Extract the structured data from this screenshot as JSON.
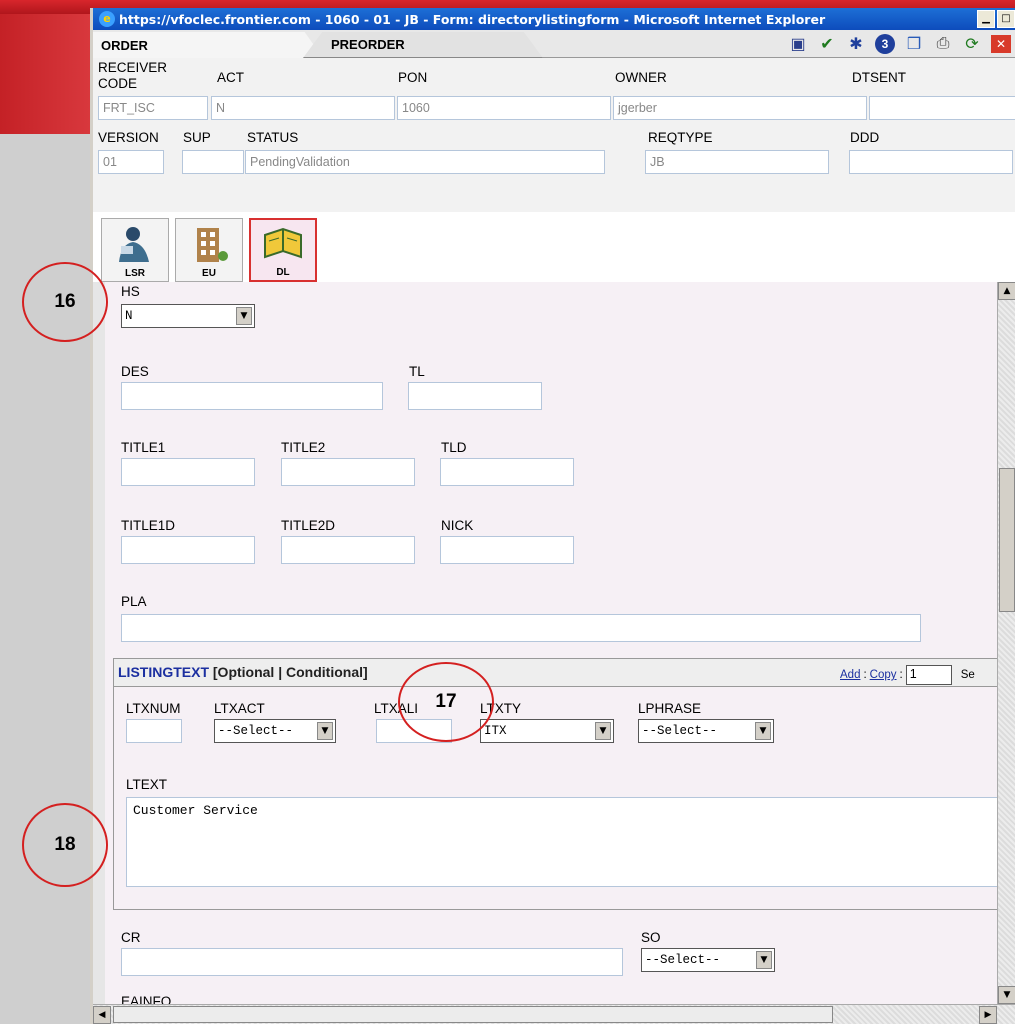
{
  "window": {
    "title": "https://vfoclec.frontier.com - 1060 - 01 - JB - Form: directorylistingform - Microsoft Internet Explorer"
  },
  "tabs": {
    "order": "ORDER",
    "preorder": "PREORDER"
  },
  "toolbar": {
    "icons": [
      "save-icon",
      "check-icon",
      "runner-icon",
      "info-3-icon",
      "book-icon",
      "print-icon",
      "refresh-icon",
      "close-icon"
    ],
    "info_number": "3"
  },
  "header": {
    "labels": {
      "receiver_code": "RECEIVER CODE",
      "act": "ACT",
      "pon": "PON",
      "owner": "OWNER",
      "dtsent": "DTSENT",
      "version": "VERSION",
      "sup": "SUP",
      "status": "STATUS",
      "reqtype": "REQTYPE",
      "ddd": "DDD"
    },
    "values": {
      "receiver_code": "FRT_ISC",
      "act": "N",
      "pon": "1060",
      "owner": "jgerber",
      "dtsent": "",
      "version": "01",
      "sup": "",
      "status": "PendingValidation",
      "reqtype": "JB",
      "ddd": ""
    }
  },
  "form_icons": {
    "lsr": "LSR",
    "eu": "EU",
    "dl": "DL"
  },
  "form": {
    "hs": {
      "label": "HS",
      "value": "N"
    },
    "des": {
      "label": "DES",
      "value": ""
    },
    "tl": {
      "label": "TL",
      "value": ""
    },
    "title1": {
      "label": "TITLE1",
      "value": ""
    },
    "title2": {
      "label": "TITLE2",
      "value": ""
    },
    "tld": {
      "label": "TLD",
      "value": ""
    },
    "title1d": {
      "label": "TITLE1D",
      "value": ""
    },
    "title2d": {
      "label": "TITLE2D",
      "value": ""
    },
    "nick": {
      "label": "NICK",
      "value": ""
    },
    "pla": {
      "label": "PLA",
      "value": ""
    },
    "listingtext": {
      "title": "LISTINGTEXT",
      "qualifier": "[Optional | Conditional]",
      "add_link": "Add",
      "separator": ":",
      "copy_link": "Copy",
      "copy_count": "1",
      "trailing": "Se",
      "ltxnum": {
        "label": "LTXNUM",
        "value": ""
      },
      "ltxact": {
        "label": "LTXACT",
        "value": "--Select--"
      },
      "ltxali": {
        "label": "LTXALI",
        "value": ""
      },
      "ltxty": {
        "label": "LTXTY",
        "value": "ITX"
      },
      "lphrase": {
        "label": "LPHRASE",
        "value": "--Select--"
      },
      "ltext": {
        "label": "LTEXT",
        "value": "Customer Service"
      }
    },
    "cr": {
      "label": "CR",
      "value": ""
    },
    "so": {
      "label": "SO",
      "value": "--Select--"
    },
    "next_label": "EAINFO"
  },
  "callouts": [
    "16",
    "17",
    "18"
  ]
}
